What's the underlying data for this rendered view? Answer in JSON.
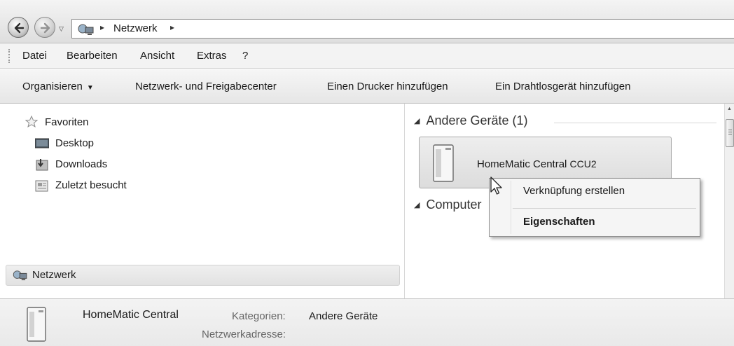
{
  "address": {
    "crumb": "Netzwerk"
  },
  "menubar": {
    "items": [
      "Datei",
      "Bearbeiten",
      "Ansicht",
      "Extras",
      "?"
    ]
  },
  "commandbar": {
    "organize": "Organisieren",
    "network_center": "Netzwerk- und Freigabecenter",
    "add_printer": "Einen Drucker hinzufügen",
    "add_wireless": "Ein Drahtlosgerät hinzufügen"
  },
  "navpane": {
    "favorites": "Favoriten",
    "desktop": "Desktop",
    "downloads": "Downloads",
    "recent": "Zuletzt besucht",
    "network": "Netzwerk"
  },
  "content": {
    "group_other": "Andere Geräte (1)",
    "group_computer": "Computer",
    "device_name": "HomeMatic Central",
    "device_suffix": "CCU2"
  },
  "context_menu": {
    "create_shortcut": "Verknüpfung erstellen",
    "properties": "Eigenschaften"
  },
  "details": {
    "name": "HomeMatic Central",
    "categories_label": "Kategorien:",
    "categories_value": "Andere Geräte",
    "address_label": "Netzwerkadresse:"
  }
}
